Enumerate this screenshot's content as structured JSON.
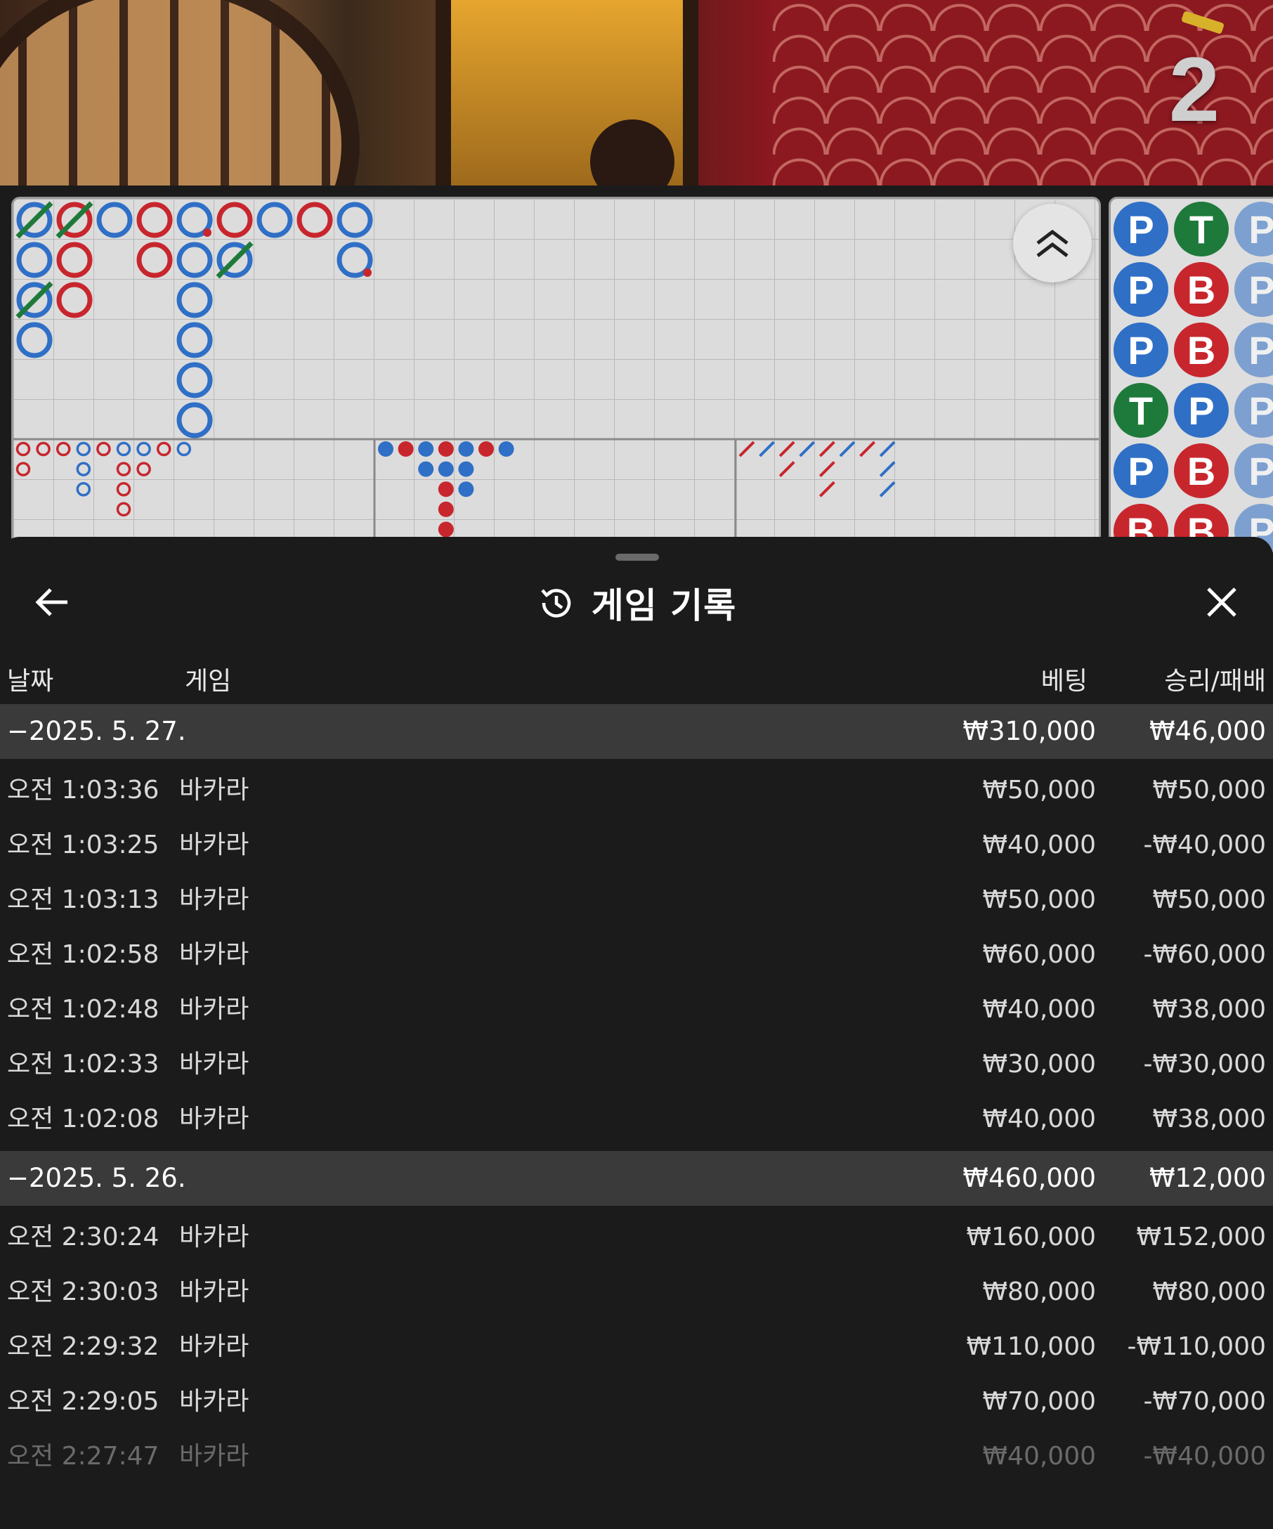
{
  "table": {
    "round_number": "2"
  },
  "big_road": {
    "blue": "#2f6fc6",
    "red": "#c8262d",
    "green": "#1e7a3a",
    "columns": [
      [
        "P-tie",
        "P",
        "P-tie",
        "P"
      ],
      [
        "B-tie",
        "B",
        "B"
      ],
      [
        "P"
      ],
      [
        "B",
        "B"
      ],
      [
        "P-pair",
        "P",
        "P",
        "P",
        "P",
        "P"
      ],
      [
        "B",
        "P-tie"
      ],
      [
        "P"
      ],
      [
        "B"
      ],
      [
        "P",
        "P-pair"
      ]
    ]
  },
  "side_beads": [
    [
      "P",
      "T",
      "P"
    ],
    [
      "P",
      "B",
      "P"
    ],
    [
      "P",
      "B",
      "P"
    ],
    [
      "T",
      "P",
      "P"
    ],
    [
      "P",
      "B",
      "P"
    ],
    [
      "B",
      "B",
      "P"
    ]
  ],
  "sheet": {
    "title": "게임 기록",
    "icons": {
      "back": "back-arrow-icon",
      "title": "history-icon",
      "close": "close-icon"
    },
    "headers": {
      "date": "날짜",
      "game": "게임",
      "bet": "베팅",
      "result": "승리/패배"
    },
    "groups": [
      {
        "date": "−2025. 5. 27.",
        "bet_total": "₩310,000",
        "result_total": "₩46,000",
        "rows": [
          {
            "time": "오전 1:03:36",
            "game": "바카라",
            "bet": "₩50,000",
            "result": "₩50,000"
          },
          {
            "time": "오전 1:03:25",
            "game": "바카라",
            "bet": "₩40,000",
            "result": "-₩40,000"
          },
          {
            "time": "오전 1:03:13",
            "game": "바카라",
            "bet": "₩50,000",
            "result": "₩50,000"
          },
          {
            "time": "오전 1:02:58",
            "game": "바카라",
            "bet": "₩60,000",
            "result": "-₩60,000"
          },
          {
            "time": "오전 1:02:48",
            "game": "바카라",
            "bet": "₩40,000",
            "result": "₩38,000"
          },
          {
            "time": "오전 1:02:33",
            "game": "바카라",
            "bet": "₩30,000",
            "result": "-₩30,000"
          },
          {
            "time": "오전 1:02:08",
            "game": "바카라",
            "bet": "₩40,000",
            "result": "₩38,000"
          }
        ]
      },
      {
        "date": "−2025. 5. 26.",
        "bet_total": "₩460,000",
        "result_total": "₩12,000",
        "rows": [
          {
            "time": "오전 2:30:24",
            "game": "바카라",
            "bet": "₩160,000",
            "result": "₩152,000"
          },
          {
            "time": "오전 2:30:03",
            "game": "바카라",
            "bet": "₩80,000",
            "result": "₩80,000"
          },
          {
            "time": "오전 2:29:32",
            "game": "바카라",
            "bet": "₩110,000",
            "result": "-₩110,000"
          },
          {
            "time": "오전 2:29:05",
            "game": "바카라",
            "bet": "₩70,000",
            "result": "-₩70,000"
          },
          {
            "time": "오전 2:27:47",
            "game": "바카라",
            "bet": "₩40,000",
            "result": "-₩40,000"
          }
        ]
      }
    ]
  }
}
